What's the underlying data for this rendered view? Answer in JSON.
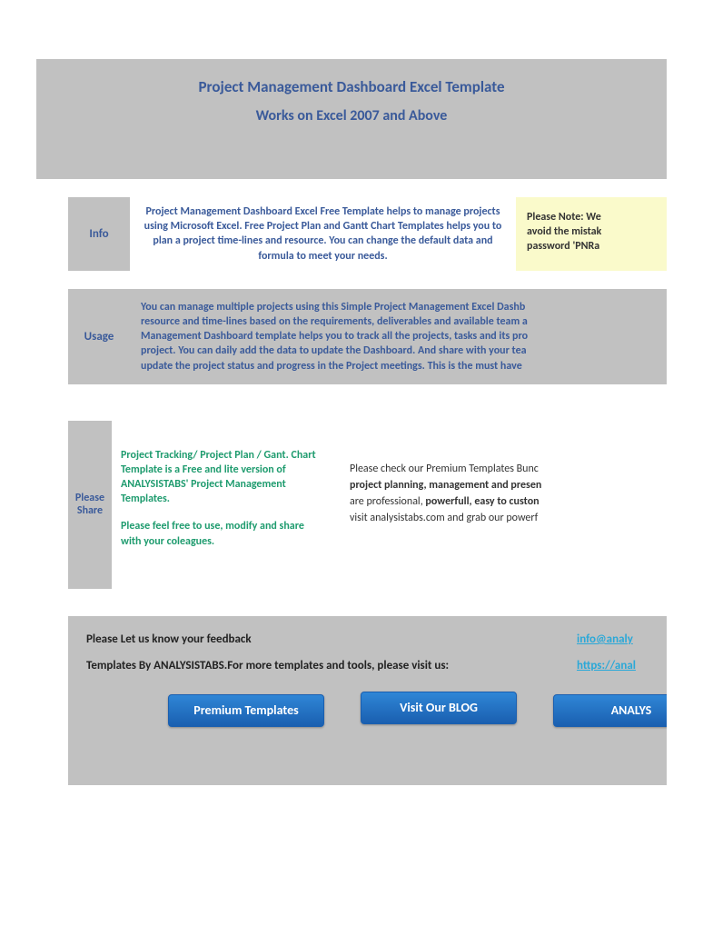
{
  "header": {
    "title": "Project Management Dashboard Excel Template",
    "subtitle": "Works on Excel 2007 and Above"
  },
  "info": {
    "label": "Info",
    "body": "Project Management Dashboard Excel Free Template helps to manage projects using Microsoft Excel. Free Project Plan and Gantt Chart Templates helps you to plan a project time-lines and resource. You can change the default data and formula to meet your needs.",
    "note_l1": "Please Note: We",
    "note_l2": "avoid the mistak",
    "note_l3": "password 'PNRa"
  },
  "usage": {
    "label": "Usage",
    "l1": "You can manage multiple projects using this Simple Project Management Excel Dashb",
    "l2": "resource and time-lines based on the requirements, deliverables and available team a",
    "l3": "Management Dashboard template helps you to track all the projects, tasks and its pro",
    "l4": "project. You can daily add the data to update the Dashboard. And share with your tea",
    "l5": "update the project status and progress in the Project meetings. This is the must have"
  },
  "share": {
    "label": "Please Share",
    "p1": "Project Tracking/ Project Plan / Gant. Chart Template is a Free and lite version of ANALYSISTABS' Project Management Templates.",
    "p2": "Please feel free to use, modify and share with your coleagues."
  },
  "premium": {
    "l1a": "Please check our Premium Templates Bunc",
    "l2a": "project planning, management and presen",
    "l3a": "are professional, ",
    "l3b": "powerfull, easy to custon",
    "l4a": "visit analysistabs.com and grab our powerf"
  },
  "footer": {
    "feedback_label": "Please Let us know your feedback",
    "feedback_link": "info@analy",
    "templates_label": "Templates By ANALYSISTABS.For more templates and tools, please visit us:",
    "templates_link": "https://anal"
  },
  "buttons": {
    "premium": "Premium Templates",
    "blog": "Visit Our BLOG",
    "analys": "ANALYS"
  }
}
